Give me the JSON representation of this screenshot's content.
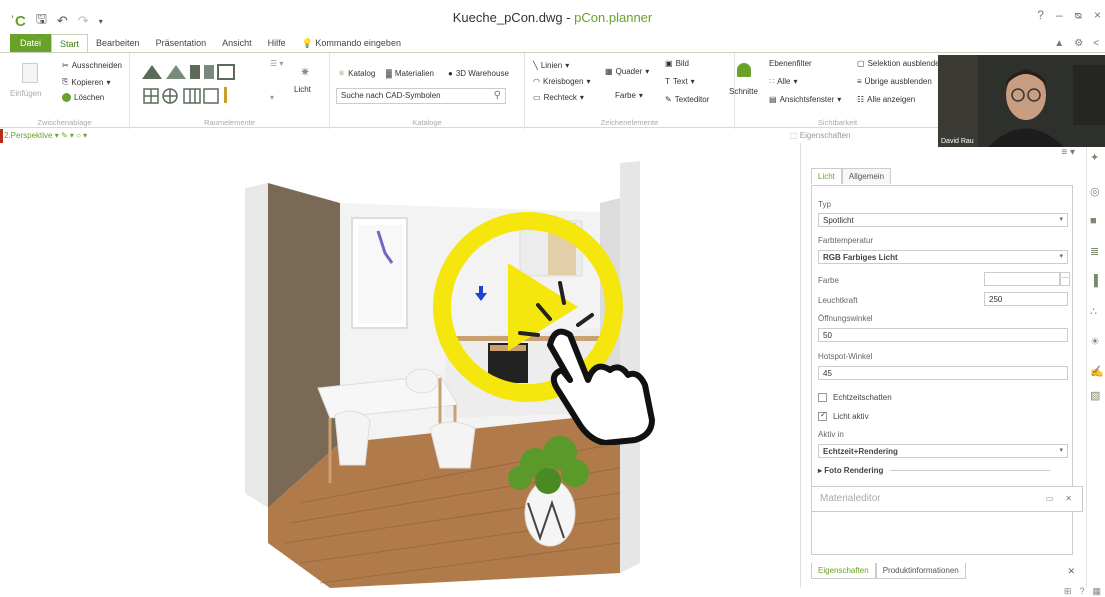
{
  "titlebar": {
    "file_name": "Kueche_pCon.dwg - ",
    "app_name": "pCon.planner",
    "window_controls": [
      "?",
      "–",
      "ᴓ",
      "×"
    ]
  },
  "ribbon_tabs": [
    "Datei",
    "Start",
    "Bearbeiten",
    "Präsentation",
    "Ansicht",
    "Hilfe",
    "Kommando eingeben"
  ],
  "ribbon": {
    "clipboard": {
      "paste": "Einfügen",
      "cut": "Ausschneiden",
      "copy": "Kopieren",
      "delete": "Löschen",
      "label": "Zwischenablage"
    },
    "room": {
      "label": "Raumelemente",
      "light": "Licht"
    },
    "catalogs": {
      "catalog": "Katalog",
      "materials": "Materialien",
      "warehouse": "3D Warehouse",
      "search_value": "Suche nach CAD-Symbolen",
      "label": "Kataloge"
    },
    "drawing": {
      "lines": "Linien",
      "arc": "Kreisbogen",
      "rect": "Rechteck",
      "cuboid": "Quader",
      "color": "Farbe",
      "image": "Bild",
      "text": "Text",
      "texteditor": "Texteditor",
      "label": "Zeichenelemente"
    },
    "visibility": {
      "sections": "Schnitte",
      "layerfilter": "Ebenenfilter",
      "all": "Alle",
      "viewwindow": "Ansichtsfenster",
      "hide_selection": "Selektion ausblenden",
      "hide_others": "Übrige ausblenden",
      "show_all": "Alle anzeigen",
      "label": "Sichtbarkeit"
    }
  },
  "viewport": {
    "title": "2.Perspektive"
  },
  "panel": {
    "title": "Eigenschaften",
    "tabs": [
      "Licht",
      "Allgemein"
    ],
    "fields": {
      "typ_label": "Typ",
      "typ_value": "Spotlicht",
      "farbtemp_label": "Farbtemperatur",
      "farbtemp_value": "RGB Farbiges Licht",
      "farbe_label": "Farbe",
      "leucht_label": "Leuchtkraft",
      "leucht_value": "250",
      "oeffnung_label": "Öffnungswinkel",
      "oeffnung_value": "50",
      "hotspot_label": "Hotspot-Winkel",
      "hotspot_value": "45",
      "echtzeit_label": "Echtzeitschatten",
      "aktiv_label": "Licht aktiv",
      "aktivin_label": "Aktiv in",
      "aktivin_value": "Echtzeit+Rendering",
      "foto_label": "Foto Rendering"
    },
    "materialeditor": "Materialeditor",
    "bottom_tabs": [
      "Eigenschaften",
      "Produktinformationen"
    ]
  },
  "webcam": {
    "name": "David Rau"
  },
  "colors": {
    "brand_green": "#6aa12a",
    "play_yellow": "#f5e60d",
    "wall_brown": "#7a6a55",
    "floor_wood": "#b07a4a"
  }
}
